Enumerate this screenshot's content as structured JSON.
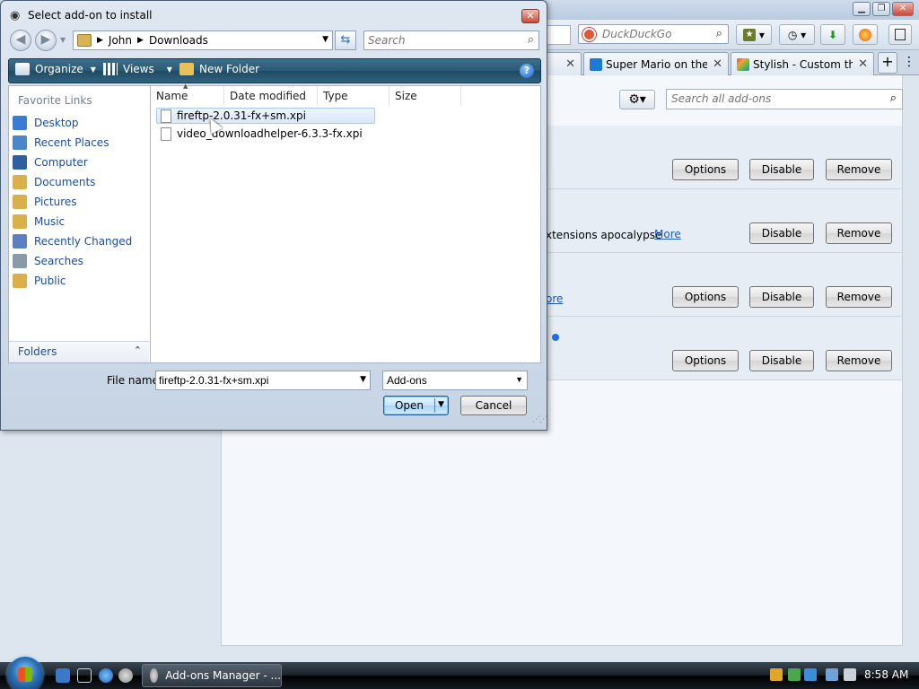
{
  "browser": {
    "search_placeholder": "DuckDuckGo",
    "tabs": [
      {
        "label": "Super Mario on the ...",
        "close": "✕"
      },
      {
        "label": "Stylish - Custom the...",
        "close": "✕"
      }
    ],
    "tab_close_first": "✕",
    "new_tab": "+",
    "addons": {
      "search_placeholder": "Search all add-ons",
      "rows": [
        {
          "text": "",
          "more": "",
          "buttons": [
            "Options",
            "Disable",
            "Remove"
          ]
        },
        {
          "text": "xtensions apocalypse",
          "more": "More",
          "buttons": [
            "Disable",
            "Remove"
          ]
        },
        {
          "text": "",
          "more": "ore",
          "buttons": [
            "Options",
            "Disable",
            "Remove"
          ]
        },
        {
          "text": "",
          "more": "",
          "buttons": [
            "Options",
            "Disable",
            "Remove"
          ]
        }
      ]
    }
  },
  "dialog": {
    "title": "Select add-on to install",
    "breadcrumb": [
      "John",
      "Downloads"
    ],
    "search_placeholder": "Search",
    "commands": {
      "organize": "Organize",
      "views": "Views",
      "new_folder": "New Folder"
    },
    "favorite_links_title": "Favorite Links",
    "favorite_links": [
      {
        "label": "Desktop",
        "icon": "desktop-icon",
        "color": "#3a7bd5"
      },
      {
        "label": "Recent Places",
        "icon": "recent-places-icon",
        "color": "#4a86c8"
      },
      {
        "label": "Computer",
        "icon": "computer-icon",
        "color": "#2f5f9e"
      },
      {
        "label": "Documents",
        "icon": "documents-icon",
        "color": "#d9b04a"
      },
      {
        "label": "Pictures",
        "icon": "pictures-icon",
        "color": "#d9b04a"
      },
      {
        "label": "Music",
        "icon": "music-icon",
        "color": "#d9b04a"
      },
      {
        "label": "Recently Changed",
        "icon": "recently-changed-icon",
        "color": "#5b7fc0"
      },
      {
        "label": "Searches",
        "icon": "searches-icon",
        "color": "#8b9aa9"
      },
      {
        "label": "Public",
        "icon": "public-icon",
        "color": "#d9b04a"
      }
    ],
    "folders_label": "Folders",
    "columns": [
      "Name",
      "Date modified",
      "Type",
      "Size"
    ],
    "files": [
      {
        "name": "fireftp-2.0.31-fx+sm.xpi",
        "selected": true
      },
      {
        "name": "video_downloadhelper-6.3.3-fx.xpi",
        "selected": false
      }
    ],
    "file_name_label": "File name:",
    "file_name_value": "fireftp-2.0.31-fx+sm.xpi",
    "file_type_value": "Add-ons",
    "open_label": "Open",
    "cancel_label": "Cancel"
  },
  "taskbar": {
    "task_label": "Add-ons Manager - ...",
    "clock": "8:58 AM"
  }
}
